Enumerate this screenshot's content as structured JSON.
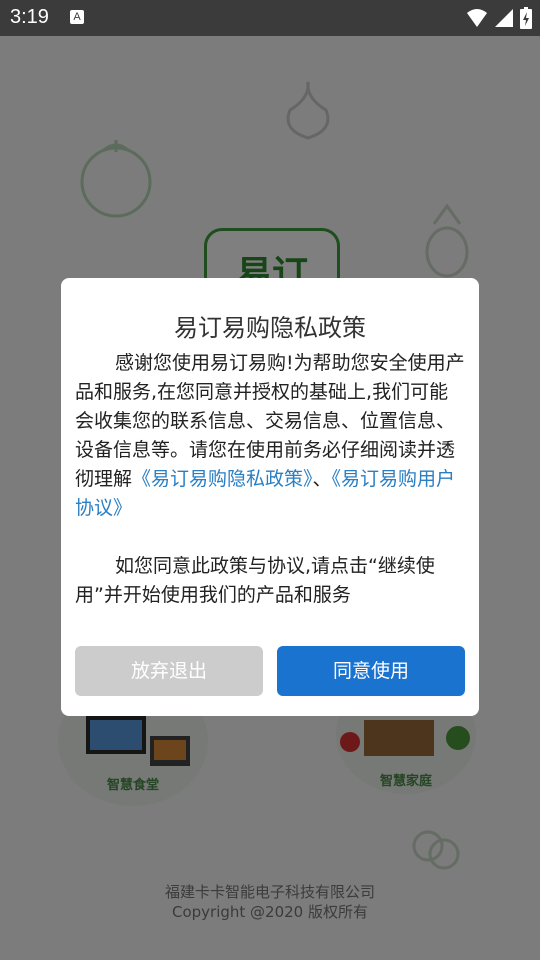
{
  "status_bar": {
    "time": "3:19",
    "notification_icon": "A"
  },
  "splash": {
    "logo_text": "易订",
    "left_card_label": "智慧食堂",
    "right_card_label": "智慧家庭",
    "company": "福建卡卡智能电子科技有限公司",
    "copyright": "Copyright @2020 版权所有"
  },
  "dialog": {
    "title": "易订易购隐私政策",
    "para1_text": "感谢您使用易订易购!为帮助您安全使用产品和服务,在您同意并授权的基础上,我们可能会收集您的联系信息、交易信息、位置信息、设备信息等。请您在使用前务必仔细阅读并透彻理解",
    "privacy_link": "《易订易购隐私政策》",
    "separator": "、",
    "agreement_link": "《易订易购用户协议》",
    "para2_text": "如您同意此政策与协议,请点击“继续使用”并开始使用我们的产品和服务",
    "exit_button": "放弃退出",
    "agree_button": "同意使用"
  },
  "colors": {
    "accent": "#1a73cf",
    "link": "#2a7fc4",
    "brand_green": "#3d9a3d"
  }
}
